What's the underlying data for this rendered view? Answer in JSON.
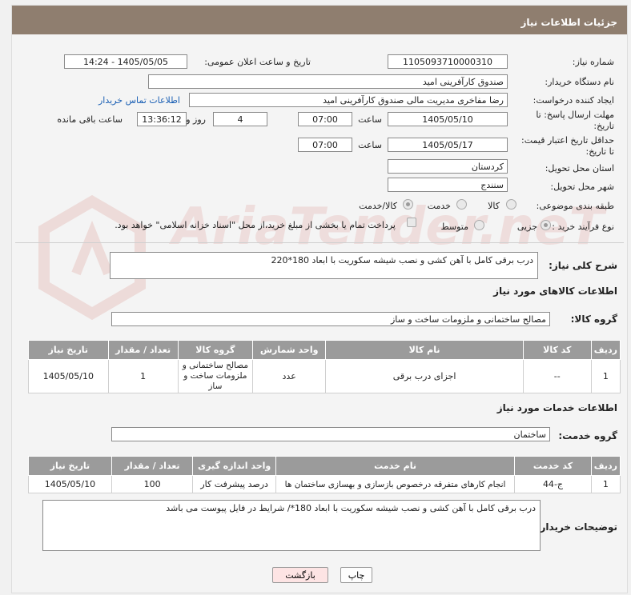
{
  "header": {
    "title": "جزئیات اطلاعات نیاز"
  },
  "fields": {
    "need_number_label": "شماره نیاز:",
    "need_number": "1105093710000310",
    "announce_label": "تاریخ و ساعت اعلان عمومی:",
    "announce_value": "1405/05/05 - 14:24",
    "buyer_org_label": "نام دستگاه خریدار:",
    "buyer_org": "صندوق کارآفرینی امید",
    "creator_label": "ایجاد کننده درخواست:",
    "creator": "رضا مفاخری مدیریت مالی صندوق کارآفرینی امید",
    "contact_link": "اطلاعات تماس خریدار",
    "send_deadline_label_1": "مهلت ارسال پاسخ: تا",
    "send_deadline_label_2": "تاریخ:",
    "send_date": "1405/05/10",
    "time_label": "ساعت",
    "send_time": "07:00",
    "days": "4",
    "days_label": "روز و",
    "remaining_time": "13:36:12",
    "remaining_label": "ساعت باقی مانده",
    "price_deadline_label_1": "حداقل تاریخ اعتبار قیمت:",
    "price_deadline_label_2": "تا تاریخ:",
    "price_date": "1405/05/17",
    "price_time": "07:00",
    "province_label": "استان محل تحویل:",
    "province": "کردستان",
    "city_label": "شهر محل تحویل:",
    "city": "سنندج",
    "category_label": "طبقه بندی موضوعی:",
    "category_options": [
      "کالا",
      "خدمت",
      "کالا/خدمت"
    ],
    "process_label": "نوع فرآیند خرید :",
    "process_options": [
      "جزیی",
      "متوسط"
    ],
    "payment_note": "پرداخت تمام یا بخشی از مبلغ خرید،از محل \"اسناد خزانه اسلامی\" خواهد بود."
  },
  "description": {
    "label": "شرح کلی نیاز:",
    "text": "درب برقی کامل با آهن کشی و نصب شیشه سکوریت با ابعاد 180*220"
  },
  "goods": {
    "section_title": "اطلاعات کالاهای مورد نیاز",
    "group_label": "گروه کالا:",
    "group_value": "مصالح ساختمانی و ملزومات ساخت و ساز",
    "columns": [
      "ردیف",
      "کد کالا",
      "نام کالا",
      "واحد شمارش",
      "گروه کالا",
      "تعداد / مقدار",
      "تاریخ نیاز"
    ],
    "rows": [
      [
        "1",
        "--",
        "اجزای درب برقی",
        "عدد",
        "مصالح ساختمانی و ملزومات ساخت و ساز",
        "1",
        "1405/05/10"
      ]
    ]
  },
  "services": {
    "section_title": "اطلاعات خدمات مورد نیاز",
    "group_label": "گروه خدمت:",
    "group_value": "ساختمان",
    "columns": [
      "ردیف",
      "کد خدمت",
      "نام خدمت",
      "واحد اندازه گیری",
      "تعداد / مقدار",
      "تاریخ نیاز"
    ],
    "rows": [
      [
        "1",
        "ج-44",
        "انجام کارهای متفرقه درخصوص بازسازی و بهسازی ساختمان ها",
        "درصد پیشرفت کار",
        "100",
        "1405/05/10"
      ]
    ]
  },
  "buyer_notes": {
    "label": "توضیحات خریدار:",
    "text": "درب برقی کامل با آهن کشی و نصب شیشه سکوریت با ابعاد 180*/ شرایط در فایل پیوست می باشد"
  },
  "buttons": {
    "print": "چاپ",
    "back": "بازگشت"
  },
  "watermark": "AriaTender.neT",
  "colors": {
    "header": "#8f7e6f",
    "table_header": "#9b9b9b",
    "link": "#1a5fb4"
  }
}
